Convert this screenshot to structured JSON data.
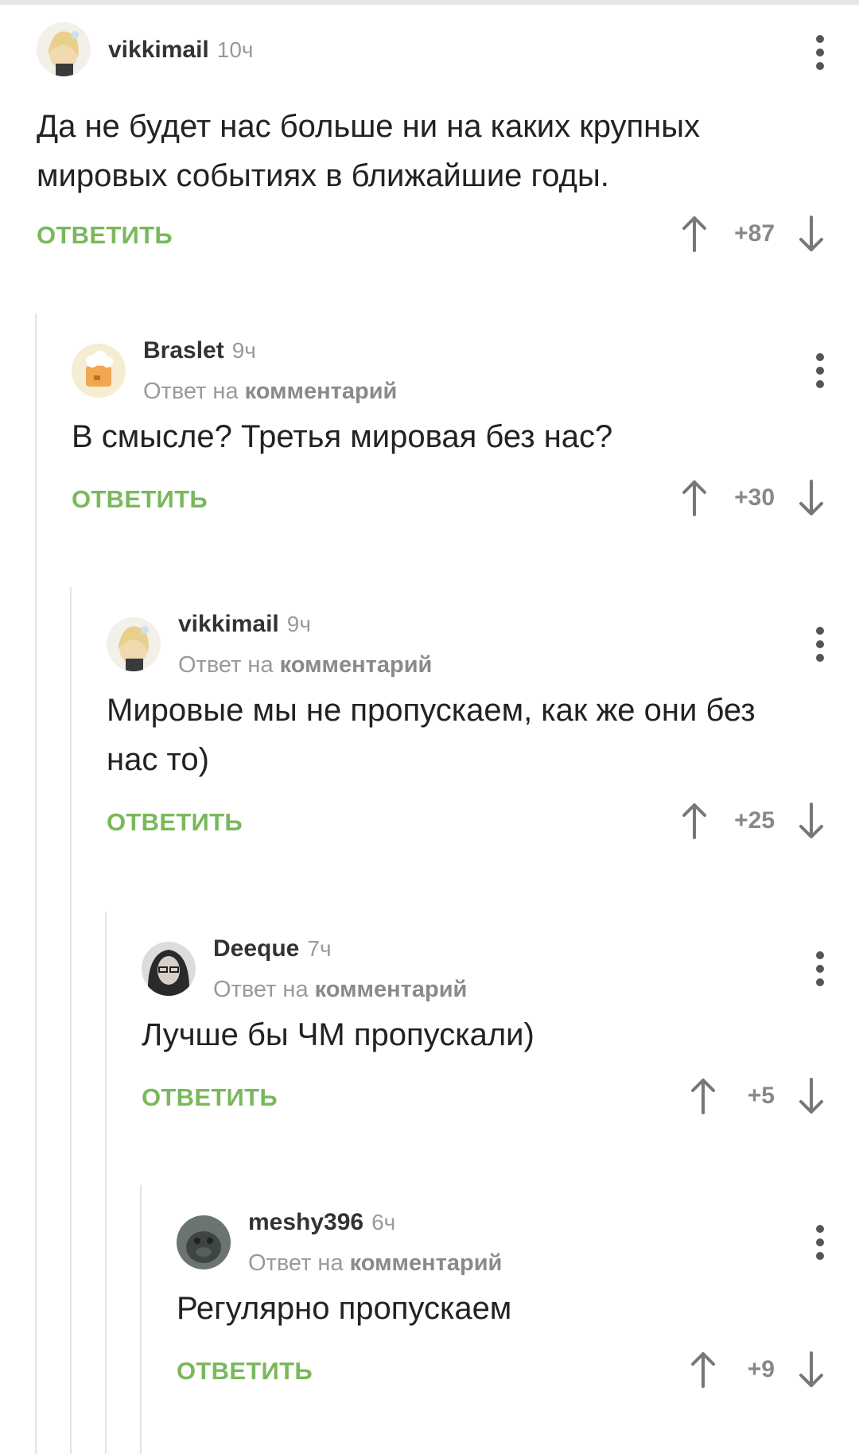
{
  "reply_label": "ОТВЕТИТЬ",
  "reply_to_prefix": "Ответ на",
  "reply_to_link": "комментарий",
  "accent_color": "#7ab85b",
  "comments": [
    {
      "author": "vikkimail",
      "time": "10ч",
      "text": "Да не будет нас больше ни на каких крупных мировых событиях в ближайшие годы.",
      "score": "+87"
    },
    {
      "author": "Braslet",
      "time": "9ч",
      "text": "В смысле? Третья мировая без нас?",
      "score": "+30"
    },
    {
      "author": "vikkimail",
      "time": "9ч",
      "text": "Мировые мы не пропускаем, как же они без нас то)",
      "score": "+25"
    },
    {
      "author": "Deeque",
      "time": "7ч",
      "text": "Лучше бы ЧМ пропускали)",
      "score": "+5"
    },
    {
      "author": "meshy396",
      "time": "6ч",
      "text": "Регулярно пропускаем",
      "score": "+9"
    }
  ],
  "icons": {
    "more": "more-vertical-icon",
    "upvote": "arrow-up-icon",
    "downvote": "arrow-down-icon"
  }
}
